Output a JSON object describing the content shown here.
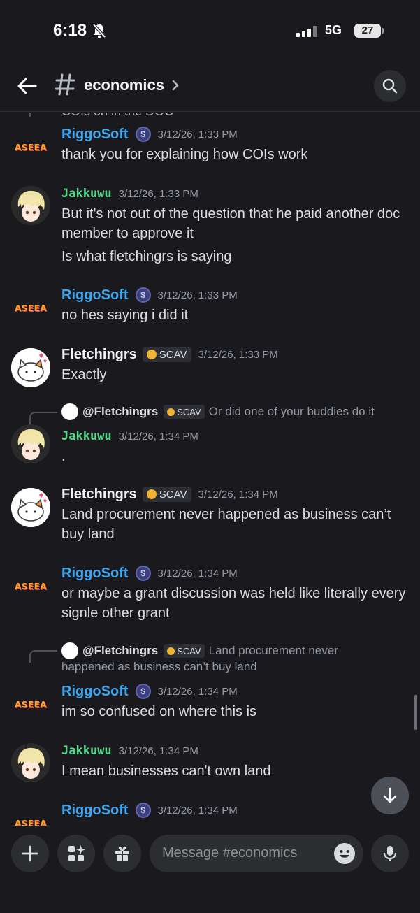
{
  "status": {
    "time": "6:18",
    "network": "5G",
    "battery": "27"
  },
  "header": {
    "channel_name": "economics"
  },
  "cut_text": "COIs on in the DOC",
  "messages": [
    {
      "author": "RiggoSoft",
      "timestamp": "3/12/26, 1:33 PM",
      "lines": [
        "thank you for explaining how COIs work"
      ]
    },
    {
      "author": "Jakkuwu",
      "timestamp": "3/12/26, 1:33 PM",
      "lines": [
        "But it's not out of the question that he paid another doc member to approve it",
        "Is what fletchingrs is saying"
      ]
    },
    {
      "author": "RiggoSoft",
      "timestamp": "3/12/26, 1:33 PM",
      "lines": [
        "no hes saying i did it"
      ]
    },
    {
      "author": "Fletchingrs",
      "tag": "SCAV",
      "timestamp": "3/12/26, 1:33 PM",
      "lines": [
        "Exactly"
      ]
    },
    {
      "reply": {
        "name": "@Fletchingrs",
        "tag": "SCAV",
        "text": "Or did one of your buddies do it"
      },
      "author": "Jakkuwu",
      "timestamp": "3/12/26, 1:34 PM",
      "lines": [
        "."
      ]
    },
    {
      "author": "Fletchingrs",
      "tag": "SCAV",
      "timestamp": "3/12/26, 1:34 PM",
      "lines": [
        "Land procurement never happened as business can’t buy land"
      ]
    },
    {
      "author": "RiggoSoft",
      "timestamp": "3/12/26, 1:34 PM",
      "lines": [
        "or maybe a grant discussion was held like literally every signle other grant"
      ]
    },
    {
      "reply": {
        "name": "@Fletchingrs",
        "tag": "SCAV",
        "text": "Land procurement never",
        "text2": "happened as business can’t buy land"
      },
      "author": "RiggoSoft",
      "timestamp": "3/12/26, 1:34 PM",
      "lines": [
        "im so confused on where this is"
      ]
    },
    {
      "author": "Jakkuwu",
      "timestamp": "3/12/26, 1:34 PM",
      "lines": [
        "I mean businesses can't own land"
      ]
    },
    {
      "author": "RiggoSoft",
      "timestamp": "3/12/26, 1:34 PM",
      "lines": []
    }
  ],
  "avatar_logo_text": "ASEEA",
  "coin_symbol": "$",
  "composer": {
    "placeholder": "Message #economics"
  },
  "colors": {
    "riggo": "#3ea6f0",
    "jakkuwu": "#57d98b",
    "background": "#1a1a1e"
  }
}
